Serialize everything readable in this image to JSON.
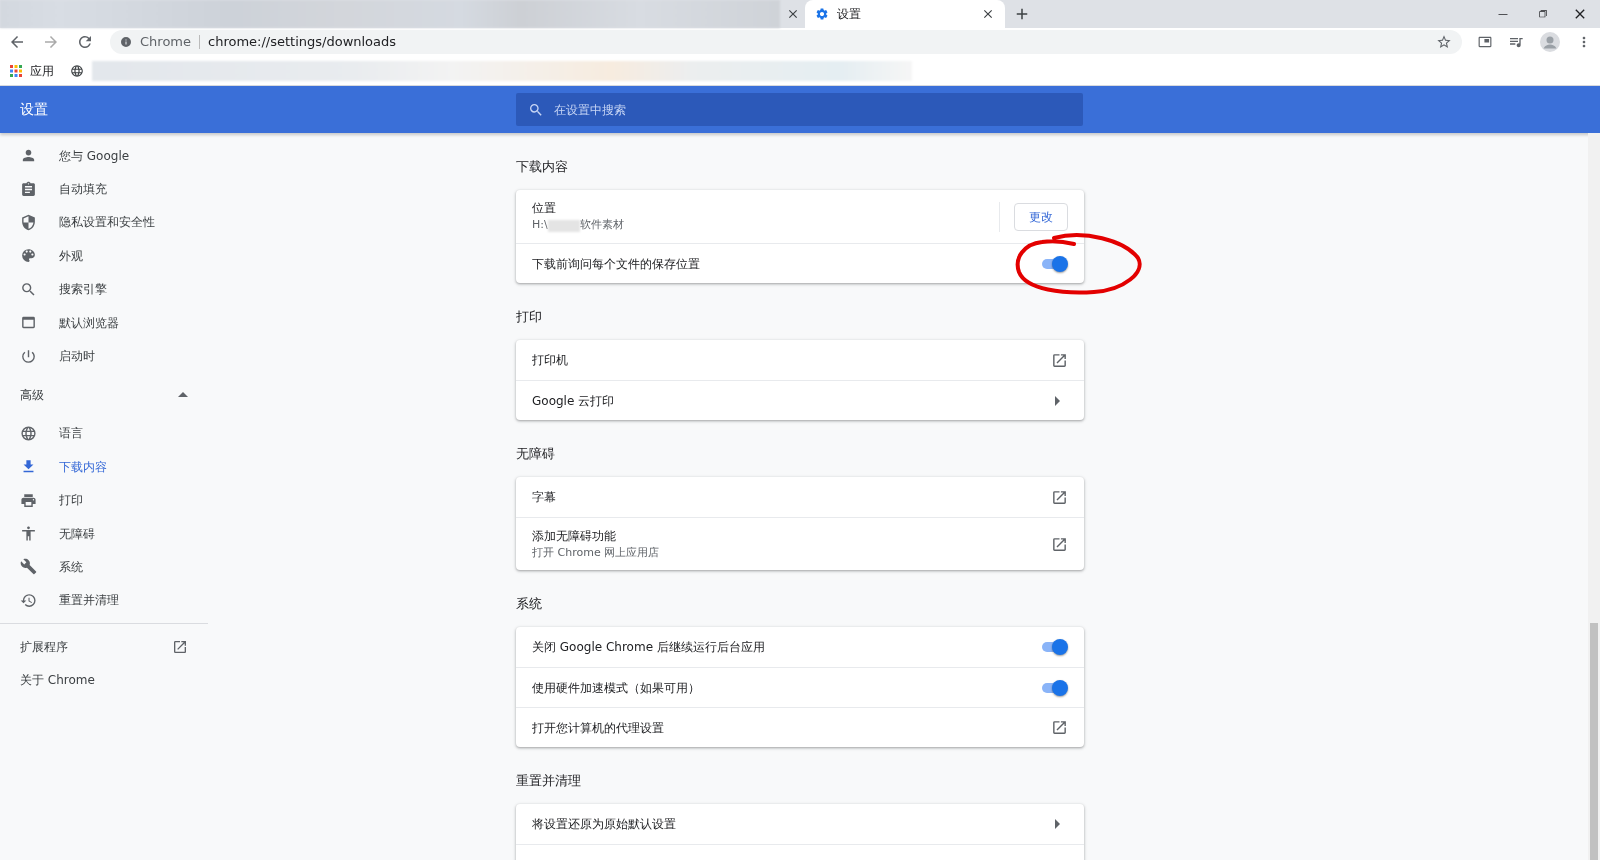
{
  "browser": {
    "active_tab": {
      "title": "设置",
      "selected": true
    },
    "omnibox": {
      "site": "Chrome",
      "url": "chrome://settings/downloads"
    },
    "bookmarks": [
      {
        "label": "应用"
      }
    ]
  },
  "header": {
    "title": "设置",
    "search": {
      "placeholder": "在设置中搜索"
    }
  },
  "sidebar": {
    "items": [
      {
        "label": "您与 Google",
        "selected": false
      },
      {
        "label": "自动填充",
        "selected": false
      },
      {
        "label": "隐私设置和安全性",
        "selected": false
      },
      {
        "label": "外观",
        "selected": false
      },
      {
        "label": "搜索引擎",
        "selected": false
      },
      {
        "label": "默认浏览器",
        "selected": false
      },
      {
        "label": "启动时",
        "selected": false
      }
    ],
    "advanced": {
      "label": "高级",
      "expanded": true,
      "items": [
        {
          "label": "语言",
          "selected": false
        },
        {
          "label": "下载内容",
          "selected": true
        },
        {
          "label": "打印",
          "selected": false
        },
        {
          "label": "无障碍",
          "selected": false
        },
        {
          "label": "系统",
          "selected": false
        },
        {
          "label": "重置并清理",
          "selected": false
        }
      ]
    },
    "footer": [
      {
        "label": "扩展程序",
        "kind": "external"
      },
      {
        "label": "关于 Chrome",
        "kind": "plain"
      }
    ]
  },
  "sections": [
    {
      "title": "下载内容",
      "rows": [
        {
          "kind": "location",
          "label": "位置",
          "path_start": "H:\\",
          "path_end": "软件素材",
          "button": "更改"
        },
        {
          "kind": "toggle",
          "label": "下载前询问每个文件的保存位置",
          "on": true,
          "annotated": true
        }
      ]
    },
    {
      "title": "打印",
      "rows": [
        {
          "kind": "external",
          "label": "打印机"
        },
        {
          "kind": "submenu",
          "label": "Google 云打印"
        }
      ]
    },
    {
      "title": "无障碍",
      "rows": [
        {
          "kind": "external",
          "label": "字幕"
        },
        {
          "kind": "external",
          "label": "添加无障碍功能",
          "sublabel": "打开 Chrome 网上应用店"
        }
      ]
    },
    {
      "title": "系统",
      "rows": [
        {
          "kind": "toggle",
          "label": "关闭 Google Chrome 后继续运行后台应用",
          "on": true
        },
        {
          "kind": "toggle",
          "label": "使用硬件加速模式（如果可用）",
          "on": true
        },
        {
          "kind": "external",
          "label": "打开您计算机的代理设置"
        }
      ]
    },
    {
      "title": "重置并清理",
      "rows": [
        {
          "kind": "submenu",
          "label": "将设置还原为原始默认设置"
        },
        {
          "kind": "blank"
        }
      ]
    }
  ]
}
